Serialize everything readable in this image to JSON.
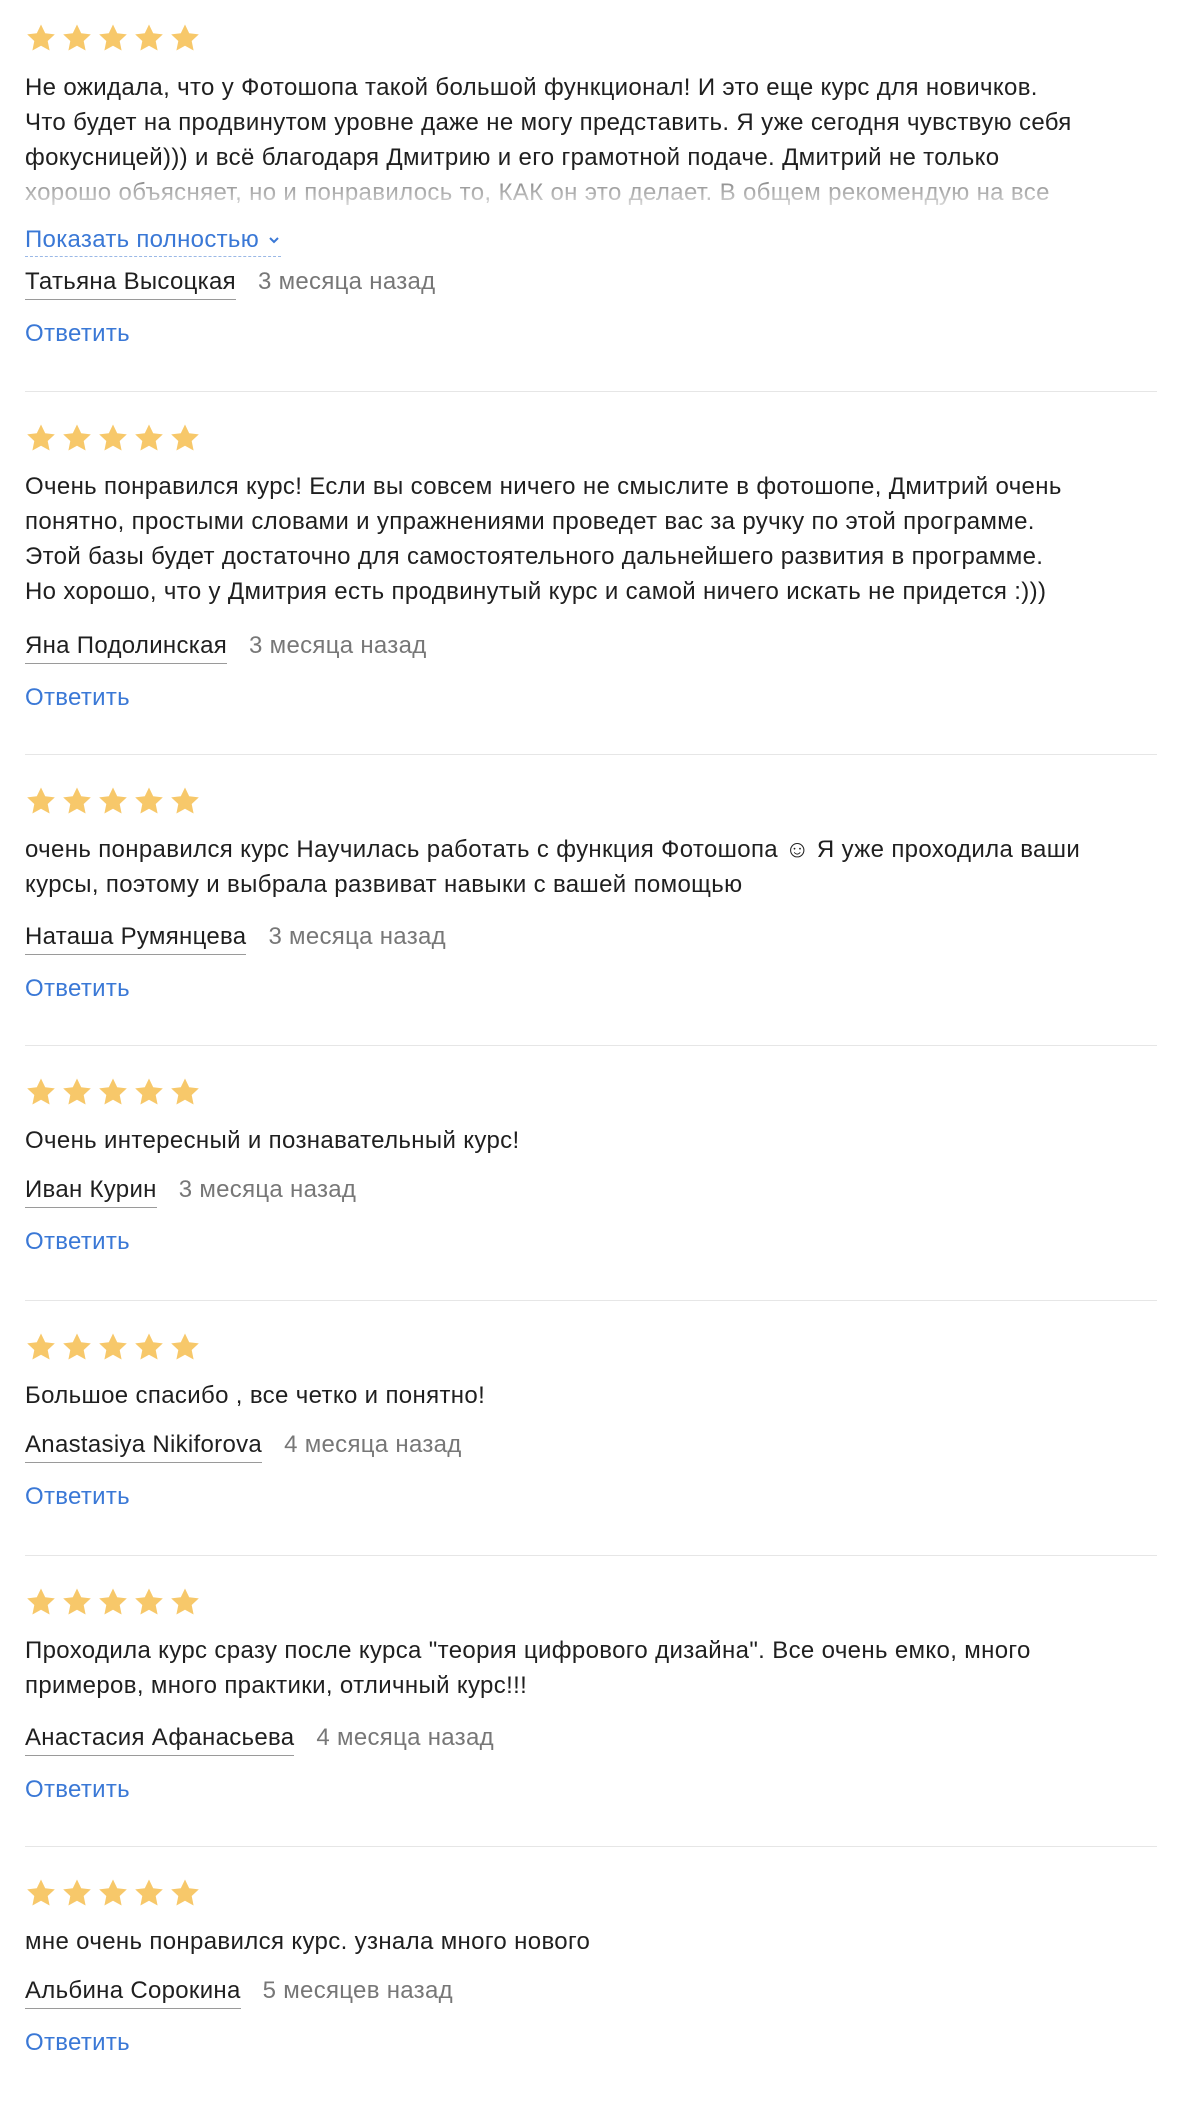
{
  "colors": {
    "star": "#F7C86A",
    "link": "#3A78D6",
    "text": "#1F1F1F",
    "muted": "#777777",
    "divider": "#E6E6E6"
  },
  "rating_icon": "star-icon",
  "show_more_label": "Показать полностью",
  "reply_label": "Ответить",
  "reviews": [
    {
      "rating": 5,
      "lines": [
        "Не ожидала, что у Фотошопа такой большой функционал! И это еще курс для новичков.",
        "Что будет на продвинутом уровне даже не могу представить. Я уже сегодня чувствую себя",
        "фокусницей))) и всё благодаря Дмитрию и его грамотной подаче. Дмитрий не только",
        "хорошо объясняет, но и понравилось то, КАК он это делает. В общем рекомендую на все"
      ],
      "author": "Татьяна Высоцкая",
      "date": "3 месяца назад"
    },
    {
      "rating": 5,
      "lines": [
        "Очень понравился курс! Если вы совсем ничего не смыслите в фотошопе, Дмитрий очень",
        "понятно, простыми словами и упражнениями проведет вас за ручку по этой программе.",
        "Этой базы будет достаточно для самостоятельного дальнейшего развития в программе.",
        "Но хорошо, что у Дмитрия есть продвинутый курс и самой ничего искать не придется :)))"
      ],
      "author": "Яна Подолинская",
      "date": "3 месяца назад"
    },
    {
      "rating": 5,
      "lines": [
        "очень понравился курс Научилась работать с функция Фотошопа ☺ Я уже проходила ваши",
        "курсы, поэтому и выбрала развиват навыки с вашей помощью"
      ],
      "author": "Наташа Румянцева",
      "date": "3 месяца назад"
    },
    {
      "rating": 5,
      "lines": [
        "Очень интересный и познавательный курс!"
      ],
      "author": "Иван Курин",
      "date": "3 месяца назад"
    },
    {
      "rating": 5,
      "lines": [
        "Большое спасибо , все четко и понятно!"
      ],
      "author": "Anastasiya Nikiforova",
      "date": "4 месяца назад"
    },
    {
      "rating": 5,
      "lines": [
        "Проходила курс сразу после курса \"теория цифрового дизайна\". Все очень емко, много",
        "примеров, много практики, отличный курс!!!"
      ],
      "author": "Анастасия Афанасьева",
      "date": "4 месяца назад"
    },
    {
      "rating": 5,
      "lines": [
        "мне очень понравился курс. узнала много нового"
      ],
      "author": "Альбина Сорокина",
      "date": "5 месяцев назад"
    }
  ]
}
